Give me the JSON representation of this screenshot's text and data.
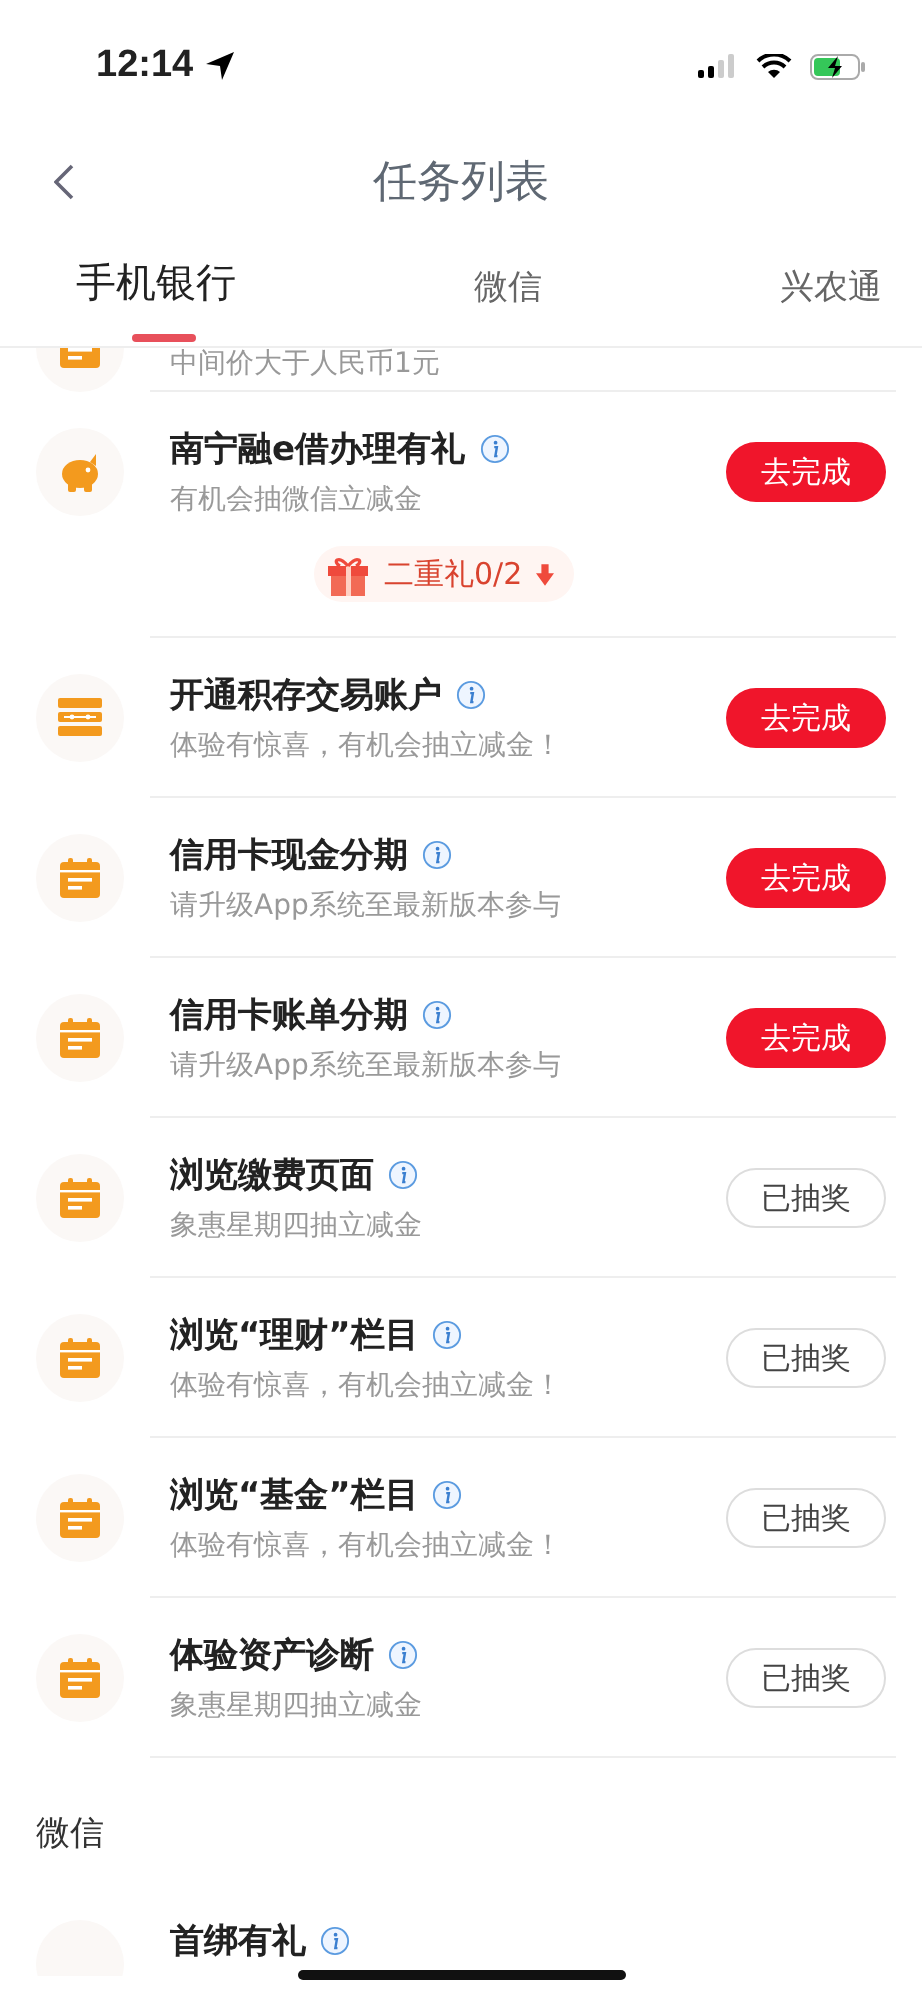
{
  "status_bar": {
    "time": "12:14"
  },
  "nav": {
    "title": "任务列表"
  },
  "tabs": [
    {
      "label": "手机银行",
      "selected": true
    },
    {
      "label": "微信",
      "selected": false
    },
    {
      "label": "兴农通",
      "selected": false
    }
  ],
  "sections": [
    {
      "tasks": [
        {
          "kind": "calendar",
          "subtitle": "中间价大于人民币1元"
        },
        {
          "kind": "piggy",
          "title": "南宁融e借办理有礼",
          "subtitle": "有机会抽微信立减金",
          "button": {
            "label": "去完成",
            "kind": "todo"
          },
          "gift": {
            "label": "二重礼0/2"
          }
        },
        {
          "kind": "abacus",
          "title": "开通积存交易账户",
          "subtitle": "体验有惊喜，有机会抽立减金！",
          "button": {
            "label": "去完成",
            "kind": "todo"
          }
        },
        {
          "kind": "calendar",
          "title": "信用卡现金分期",
          "subtitle": "请升级App系统至最新版本参与",
          "button": {
            "label": "去完成",
            "kind": "todo"
          }
        },
        {
          "kind": "calendar",
          "title": "信用卡账单分期",
          "subtitle": "请升级App系统至最新版本参与",
          "button": {
            "label": "去完成",
            "kind": "todo"
          }
        },
        {
          "kind": "calendar",
          "title": "浏览缴费页面",
          "subtitle": "象惠星期四抽立减金",
          "button": {
            "label": "已抽奖",
            "kind": "done"
          }
        },
        {
          "kind": "calendar",
          "title": "浏览“理财”栏目",
          "subtitle": "体验有惊喜，有机会抽立减金！",
          "button": {
            "label": "已抽奖",
            "kind": "done"
          }
        },
        {
          "kind": "calendar",
          "title": "浏览“基金”栏目",
          "subtitle": "体验有惊喜，有机会抽立减金！",
          "button": {
            "label": "已抽奖",
            "kind": "done"
          }
        },
        {
          "kind": "calendar",
          "title": "体验资产诊断",
          "subtitle": "象惠星期四抽立减金",
          "button": {
            "label": "已抽奖",
            "kind": "done"
          }
        }
      ]
    },
    {
      "heading": "微信",
      "tasks": [
        {
          "kind": "blank",
          "title": "首绑有礼"
        }
      ]
    }
  ]
}
